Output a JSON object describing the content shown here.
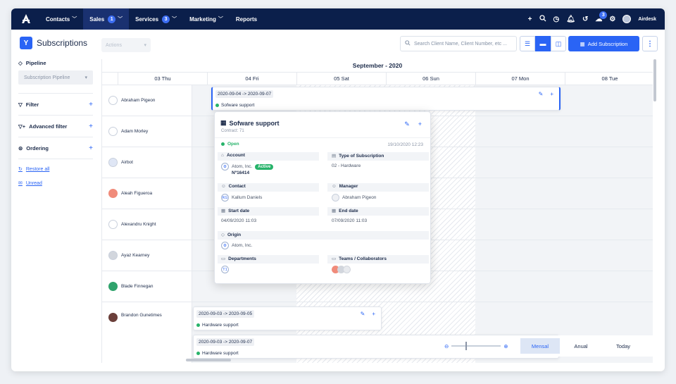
{
  "nav": {
    "items": [
      {
        "label": "Contacts",
        "badge": "",
        "active": false
      },
      {
        "label": "Sales",
        "badge": "1",
        "active": true
      },
      {
        "label": "Services",
        "badge": "3",
        "active": false
      },
      {
        "label": "Marketing",
        "badge": "",
        "active": false
      },
      {
        "label": "Reports",
        "badge": "",
        "active": false
      }
    ],
    "notif_badge": "3",
    "user": "Airdesk"
  },
  "header": {
    "title": "Subscriptions",
    "actions": "Actions",
    "search_placeholder": "Search Client Name, Client Number, etc ...",
    "add_label": "Add Subscription"
  },
  "sidebar": {
    "pipeline": "Pipeline",
    "pipeline_select": "Subscription Pipeline",
    "filter": "Filter",
    "advanced_filter": "Advanced filter",
    "ordering": "Ordering",
    "restore": "Restore all",
    "unread": "Unread"
  },
  "calendar": {
    "month": "September - 2020",
    "days": [
      "03 Thu",
      "04 Fri",
      "05 Sat",
      "06 Sun",
      "07 Mon",
      "08 Tue"
    ],
    "rows": [
      "Abraham Pigeon",
      "Adam Morley",
      "Airbot",
      "Aleah Figueroa",
      "Alexandru Knight",
      "Ayaz Kearney",
      "Blade Finnegan",
      "Brandon Gunetimes"
    ],
    "row_colors": [
      "#ffffff",
      "#ffffff",
      "#dfe6f5",
      "#f08b7a",
      "#ffffff",
      "#d2d6dd",
      "#2fa36c",
      "#6b3f3a"
    ]
  },
  "events": [
    {
      "dates": "2020-09-04 -> 2020-09-07",
      "title": "Sofware support"
    },
    {
      "dates": "2020-09-03 -> 2020-09-05",
      "title": "Hardware support"
    },
    {
      "dates": "2020-09-03 -> 2020-09-07",
      "title": "Hardware support"
    }
  ],
  "popup": {
    "title": "Sofware support",
    "contract": "Contract: 71",
    "status": "Open",
    "timestamp": "19/10/2020 12:23",
    "account_label": "Account",
    "account_name": "Atom, Inc.",
    "account_badge": "Active",
    "account_num": "Nº16414",
    "type_label": "Type of Subscription",
    "type_value": "02 - Hardware",
    "contact_label": "Contact",
    "contact_initials": "KG",
    "contact_name": "Kallum Daniels",
    "manager_label": "Manager",
    "manager_name": "Abraham Pigeon",
    "start_label": "Start date",
    "start_value": "04/09/2020 11:03",
    "end_label": "End date",
    "end_value": "07/09/2020 11:03",
    "origin_label": "Origin",
    "origin_value": "Atom, Inc.",
    "departments_label": "Departments",
    "departments_value": "T1",
    "teams_label": "Teams / Collaborators"
  },
  "footer": {
    "mensal": "Mensal",
    "anual": "Anual",
    "today": "Today"
  }
}
